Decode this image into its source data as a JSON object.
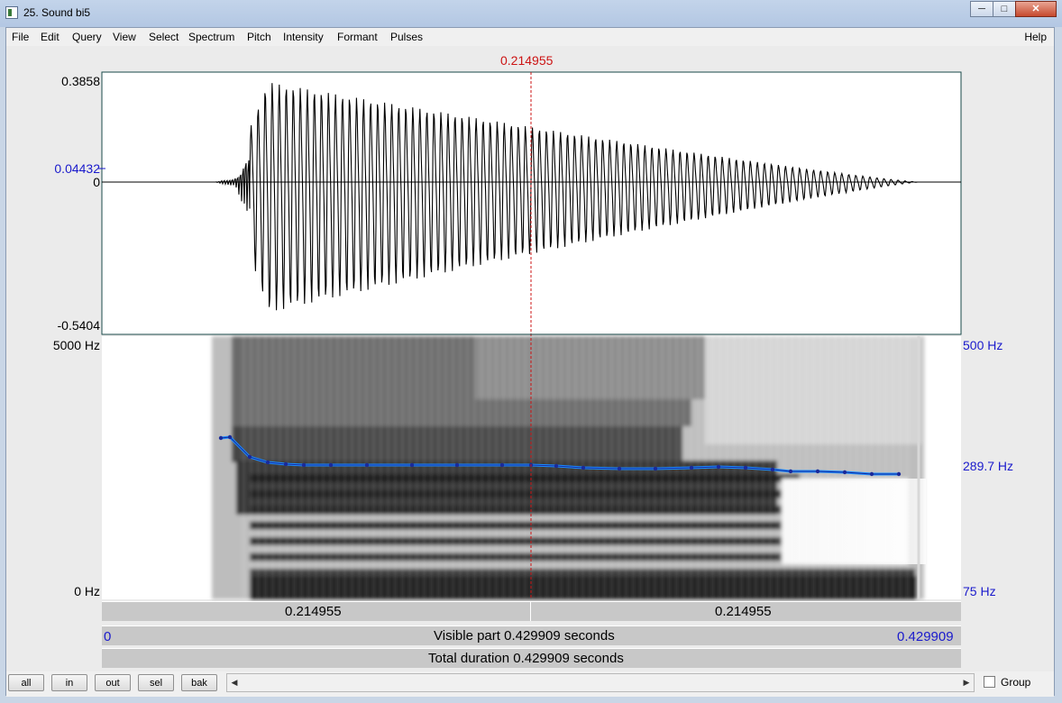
{
  "window": {
    "title": "25. Sound bi5",
    "minimize": "─",
    "maximize": "□",
    "close": "✕"
  },
  "menu": [
    "File",
    "Edit",
    "Query",
    "View",
    "Select",
    "Spectrum",
    "Pitch",
    "Intensity",
    "Formant",
    "Pulses"
  ],
  "help": "Help",
  "cursor_time": "0.214955",
  "waveform": {
    "y_max": "0.3858",
    "y_cursor": "0.04432",
    "y_zero": "0",
    "y_min": "-0.5404"
  },
  "spectrogram": {
    "freq_max": "5000 Hz",
    "freq_min": "0 Hz"
  },
  "pitch": {
    "max": "500 Hz",
    "current": "289.7 Hz",
    "min": "75 Hz"
  },
  "time_strip": {
    "left_segment": "0.214955",
    "right_segment": "0.214955",
    "visible_start": "0",
    "visible_label": "Visible part 0.429909 seconds",
    "visible_end": "0.429909",
    "total_label": "Total duration 0.429909 seconds"
  },
  "buttons": {
    "all": "all",
    "in": "in",
    "out": "out",
    "sel": "sel",
    "bak": "bak"
  },
  "group_label": "Group",
  "colors": {
    "cursor": "#cc1414",
    "pitch_line": "#1a8cff",
    "blue_text": "#1a1acc"
  }
}
